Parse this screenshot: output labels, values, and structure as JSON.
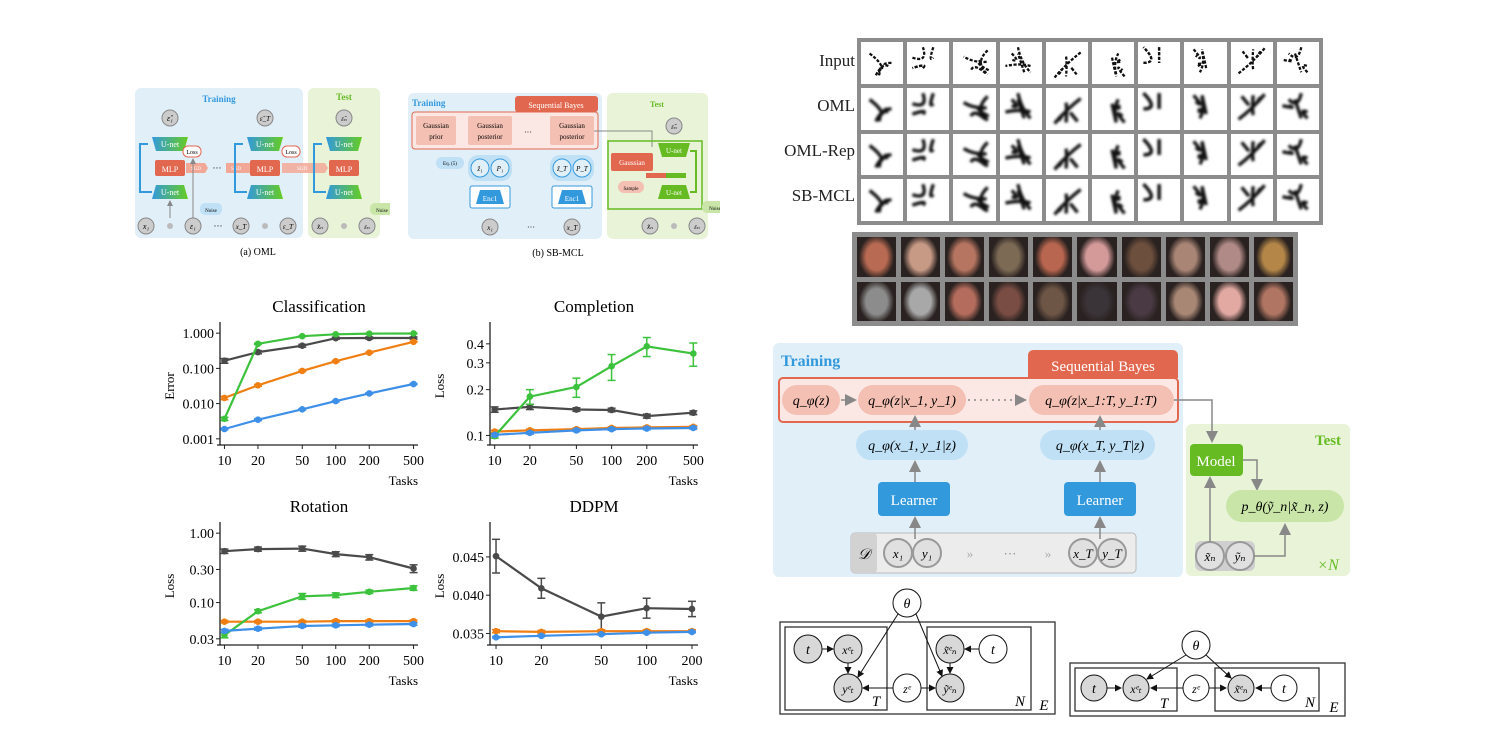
{
  "figure_oml": {
    "caption": "(a) OML",
    "training_label": "Training",
    "test_label": "Test",
    "unet_label": "U-net",
    "mlp_label": "MLP",
    "loss_label": "Loss",
    "sgd_label": "SGD",
    "noise_label": "Noise",
    "ellipsis": "···",
    "nodes": {
      "eps_hat_1": "ε̂₁",
      "eps_hat_T": "ε̂_T",
      "eps_hat_n": "ε̂ₙ",
      "x1": "x₁",
      "eps1": "ε₁",
      "xT": "x_T",
      "epsT": "ε_T",
      "xn": "x̃ₙ",
      "epsn": "εₙ"
    }
  },
  "figure_sbmcl": {
    "caption": "(b) SB-MCL",
    "training_label": "Training",
    "test_label": "Test",
    "seq_bayes_label": "Sequential Bayes",
    "gaussian_prior": [
      "Gaussian",
      "prior"
    ],
    "gaussian_posterior": [
      "Gaussian",
      "posterior"
    ],
    "eq_label": "Eq. (5)",
    "enc_label": "Enc1",
    "gaussian_label": "Gaussian",
    "sample_label": "Sample",
    "unet_label": "U-net",
    "noise_label": "Noise",
    "ellipsis": "···",
    "nodes": {
      "z1": "ẑ₁",
      "P1": "P₁",
      "zT": "ẑ_T",
      "PT": "P_T",
      "x1": "x₁",
      "xT": "x_T",
      "eps_hat_n": "ε̂ₙ",
      "xn": "x̃ₙ",
      "epsn": "εₙ"
    }
  },
  "omniglot": {
    "row_labels": [
      "Input",
      "OML",
      "OML-Rep",
      "SB-MCL"
    ],
    "columns": 10
  },
  "faces": {
    "rows": 2,
    "columns": 10
  },
  "framework": {
    "training_label": "Training",
    "seq_bayes_label": "Sequential Bayes",
    "test_label": "Test",
    "posteriors": [
      "q_φ(z)",
      "q_φ(z|x_1, y_1)",
      "q_φ(z|x_1:T, y_1:T)"
    ],
    "likelihoods": [
      "q_φ(x_1, y_1|z)",
      "q_φ(x_T, y_T|z)"
    ],
    "learner_label": "Learner",
    "dataset_label": "𝒟",
    "dataset_items": [
      "x₁",
      "y₁",
      "x_T",
      "y_T"
    ],
    "chevron": "»",
    "ellipsis": "···",
    "model_label": "Model",
    "predictive": "p_θ(ỹ_n|x̃_n, z)",
    "test_items": [
      "x̃ₙ",
      "ỹₙ"
    ],
    "repeat_label": "×N"
  },
  "graphical_model_supervised": {
    "nodes": [
      "θ",
      "t",
      "xᵉₜ",
      "yᵉₜ",
      "zᵉ",
      "x̃ᵉₙ",
      "ỹᵉₙ",
      "t"
    ],
    "plates": [
      "T",
      "N",
      "E"
    ]
  },
  "graphical_model_unsupervised": {
    "nodes": [
      "θ",
      "t",
      "xᵉₜ",
      "zᵉ",
      "x̃ᵉₙ",
      "t"
    ],
    "plates": [
      "T",
      "N",
      "E"
    ]
  },
  "colors": {
    "gray": "#4a4a4a",
    "orange": "#f07f13",
    "green": "#3cc23c",
    "blue": "#3d8fe8",
    "training_bg": "#e1eff9",
    "test_bg": "#e8f3d8",
    "seq_red": "#e2674f",
    "learner_blue": "#3399dd",
    "model_green": "#66bb22"
  },
  "chart_data": [
    {
      "type": "line",
      "title": "Classification",
      "xlabel": "Tasks",
      "ylabel": "Error",
      "xscale": "log",
      "yscale": "log",
      "x": [
        10,
        20,
        50,
        100,
        200,
        500
      ],
      "xticks": [
        "10",
        "20",
        "50",
        "100",
        "200",
        "500"
      ],
      "yticks": [
        0.001,
        0.01,
        0.1,
        1.0
      ],
      "ytick_labels": [
        "0.001",
        "0.010",
        "0.100",
        "1.000"
      ],
      "ylim": [
        0.001,
        1.0
      ],
      "series": [
        {
          "color": "gray",
          "values": [
            0.165,
            0.29,
            0.44,
            0.72,
            0.73,
            0.73
          ],
          "err": [
            0.025,
            0.03,
            0.04,
            0.05,
            0.05,
            0.05
          ]
        },
        {
          "color": "orange",
          "values": [
            0.0145,
            0.033,
            0.085,
            0.16,
            0.28,
            0.57
          ],
          "err": [
            0.0015,
            0.002,
            0.004,
            0.008,
            0.01,
            0.02
          ]
        },
        {
          "color": "green",
          "values": [
            0.0037,
            0.5,
            0.82,
            0.93,
            0.97,
            0.98
          ],
          "err": [
            0.0004,
            0.02,
            0.02,
            0.02,
            0.02,
            0.02
          ]
        },
        {
          "color": "blue",
          "values": [
            0.0019,
            0.0035,
            0.0069,
            0.0118,
            0.0195,
            0.036
          ],
          "err": [
            0.0001,
            0.0002,
            0.0003,
            0.0005,
            0.0008,
            0.0015
          ]
        }
      ]
    },
    {
      "type": "line",
      "title": "Completion",
      "xlabel": "Tasks",
      "ylabel": "Loss",
      "xscale": "log",
      "yscale": "log",
      "x": [
        10,
        20,
        50,
        100,
        200,
        500
      ],
      "xticks": [
        "10",
        "20",
        "50",
        "100",
        "200",
        "500"
      ],
      "yticks": [
        0.1,
        0.2,
        0.3,
        0.4
      ],
      "ytick_labels": [
        "0.1",
        "0.2",
        "0.3",
        "0.4"
      ],
      "ylim": [
        0.095,
        0.47
      ],
      "series": [
        {
          "color": "gray",
          "values": [
            0.148,
            0.154,
            0.148,
            0.147,
            0.134,
            0.141
          ],
          "err": [
            0.006,
            0.006,
            0.004,
            0.004,
            0.004,
            0.004
          ]
        },
        {
          "color": "orange",
          "values": [
            0.106,
            0.108,
            0.11,
            0.112,
            0.113,
            0.114
          ],
          "err": [
            0.002,
            0.002,
            0.002,
            0.002,
            0.002,
            0.002
          ]
        },
        {
          "color": "green",
          "values": [
            0.099,
            0.18,
            0.208,
            0.285,
            0.385,
            0.345
          ],
          "err": [
            0.003,
            0.02,
            0.03,
            0.055,
            0.055,
            0.06
          ]
        },
        {
          "color": "blue",
          "values": [
            0.101,
            0.104,
            0.108,
            0.11,
            0.111,
            0.112
          ],
          "err": [
            0.002,
            0.002,
            0.002,
            0.002,
            0.002,
            0.002
          ]
        }
      ]
    },
    {
      "type": "line",
      "title": "Rotation",
      "xlabel": "Tasks",
      "ylabel": "Loss",
      "xscale": "log",
      "yscale": "log",
      "x": [
        10,
        20,
        50,
        100,
        200,
        500
      ],
      "xticks": [
        "10",
        "20",
        "50",
        "100",
        "200",
        "500"
      ],
      "yticks": [
        0.03,
        0.1,
        0.3,
        1.0
      ],
      "ytick_labels": [
        "0.03",
        "0.10",
        "0.30",
        "1.00"
      ],
      "ylim": [
        0.03,
        1.0
      ],
      "series": [
        {
          "color": "gray",
          "values": [
            0.55,
            0.59,
            0.6,
            0.5,
            0.45,
            0.31
          ],
          "err": [
            0.04,
            0.04,
            0.05,
            0.04,
            0.04,
            0.04
          ]
        },
        {
          "color": "orange",
          "values": [
            0.053,
            0.053,
            0.053,
            0.054,
            0.054,
            0.054
          ],
          "err": [
            0.002,
            0.002,
            0.002,
            0.002,
            0.002,
            0.002
          ]
        },
        {
          "color": "green",
          "values": [
            0.034,
            0.075,
            0.123,
            0.128,
            0.143,
            0.162
          ],
          "err": [
            0.003,
            0.004,
            0.012,
            0.01,
            0.008,
            0.012
          ]
        },
        {
          "color": "blue",
          "values": [
            0.039,
            0.042,
            0.046,
            0.047,
            0.048,
            0.049
          ],
          "err": [
            0.002,
            0.002,
            0.002,
            0.002,
            0.002,
            0.002
          ]
        }
      ]
    },
    {
      "type": "line",
      "title": "DDPM",
      "xlabel": "Tasks",
      "ylabel": "Loss",
      "xscale": "log",
      "yscale": "linear",
      "x": [
        10,
        20,
        50,
        100,
        200
      ],
      "xticks": [
        "10",
        "20",
        "50",
        "100",
        "200"
      ],
      "yticks": [
        0.035,
        0.04,
        0.045
      ],
      "ytick_labels": [
        "0.035",
        "0.040",
        "0.045"
      ],
      "ylim": [
        0.0343,
        0.0481
      ],
      "series": [
        {
          "color": "gray",
          "values": [
            0.0451,
            0.0409,
            0.0372,
            0.0383,
            0.0382
          ],
          "err": [
            0.0022,
            0.0013,
            0.0018,
            0.0013,
            0.001
          ]
        },
        {
          "color": "orange",
          "values": [
            0.0353,
            0.0352,
            0.0353,
            0.0353,
            0.0353
          ],
          "err": [
            0.0002,
            0.0002,
            0.0002,
            0.0002,
            0.0002
          ]
        },
        {
          "color": "blue",
          "values": [
            0.0345,
            0.0347,
            0.0349,
            0.0351,
            0.0352
          ],
          "err": [
            0.0001,
            0.0001,
            0.0001,
            0.0001,
            0.0001
          ]
        }
      ]
    }
  ]
}
